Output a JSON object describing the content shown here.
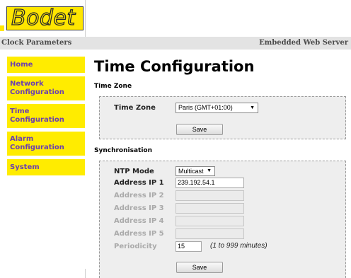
{
  "brand": {
    "logo_text": "Bodet"
  },
  "header": {
    "left_title": "Clock Parameters",
    "right_title": "Embedded Web Server"
  },
  "sidebar": {
    "items": [
      {
        "label": "Home"
      },
      {
        "label": "Network Configuration"
      },
      {
        "label": "Time Configuration"
      },
      {
        "label": "Alarm Configuration"
      },
      {
        "label": "System"
      }
    ]
  },
  "main": {
    "title": "Time Configuration",
    "time_zone": {
      "heading": "Time Zone",
      "label": "Time Zone",
      "selected": "Paris    (GMT+01:00)",
      "save_label": "Save"
    },
    "sync": {
      "heading": "Synchronisation",
      "ntp_mode_label": "NTP Mode",
      "ntp_mode_value": "Multicast",
      "address_ip1_label": "Address IP 1",
      "address_ip1_value": "239.192.54.1",
      "address_ip2_label": "Address IP 2",
      "address_ip3_label": "Address IP 3",
      "address_ip4_label": "Address IP 4",
      "address_ip5_label": "Address IP 5",
      "periodicity_label": "Periodicity",
      "periodicity_value": "15",
      "periodicity_hint": "(1 to 999 minutes)",
      "save_label": "Save"
    }
  },
  "colors": {
    "accent_yellow": "#ffec00",
    "nav_text": "#6b3fb0",
    "panel_bg": "#eeeeee"
  }
}
